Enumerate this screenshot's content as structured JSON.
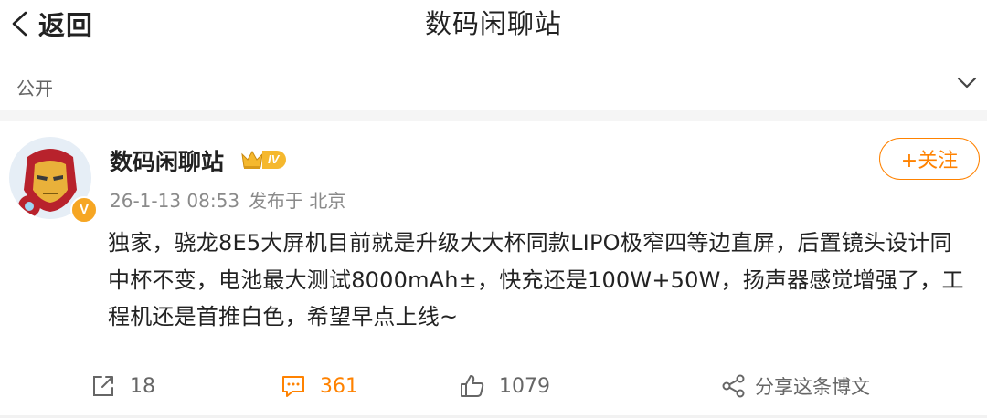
{
  "header": {
    "back_label": "返回",
    "title": "数码闲聊站"
  },
  "visibility": {
    "label": "公开"
  },
  "post": {
    "author": "数码闲聊站",
    "level": "IV",
    "verified_mark": "V",
    "time": "26-1-13 08:53",
    "source": "发布于 北京",
    "follow_label": "+关注",
    "text": "独家，骁龙8E5大屏机目前就是升级大大杯同款LIPO极窄四等边直屏，后置镜头设计同中杯不变，电池最大测试8000mAh±，快充还是100W+50W，扬声器感觉增强了，工程机还是首推白色，希望早点上线~"
  },
  "actions": {
    "repost_count": "18",
    "comment_count": "361",
    "like_count": "1079",
    "share_label": "分享这条博文"
  },
  "colors": {
    "accent": "#ff8200",
    "badge": "#f5b82e",
    "muted": "#8a8a8a"
  },
  "icons": [
    "chevron-left-icon",
    "chevron-down-icon",
    "crown-icon",
    "repost-icon",
    "comment-icon",
    "like-icon",
    "share-icon"
  ]
}
